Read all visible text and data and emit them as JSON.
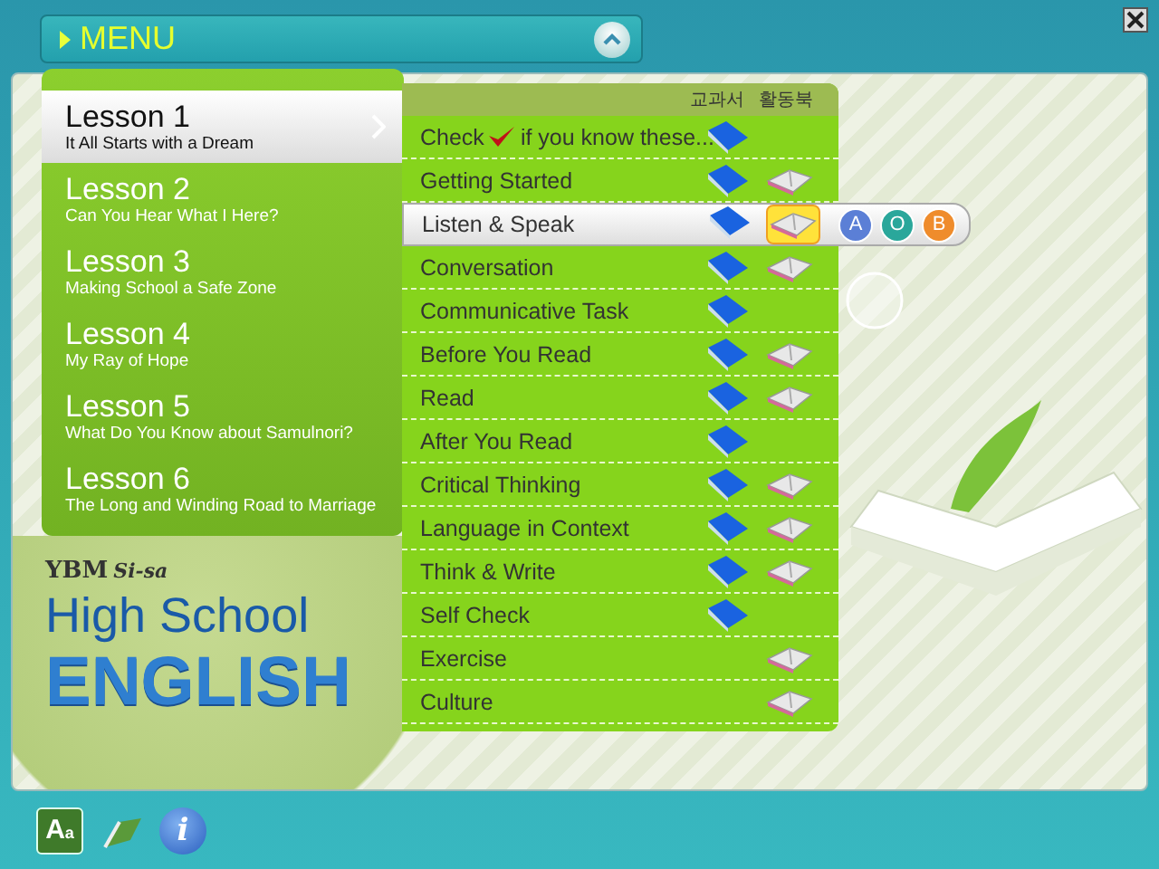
{
  "menu": {
    "title": "MENU",
    "expanded": true
  },
  "lessons": [
    {
      "title": "Lesson 1",
      "subtitle": "It All Starts with a Dream",
      "selected": true
    },
    {
      "title": "Lesson 2",
      "subtitle": "Can You Hear What I Here?",
      "selected": false
    },
    {
      "title": "Lesson 3",
      "subtitle": "Making School a Safe Zone",
      "selected": false
    },
    {
      "title": "Lesson 4",
      "subtitle": "My Ray of Hope",
      "selected": false
    },
    {
      "title": "Lesson 5",
      "subtitle": "What Do You Know about Samulnori?",
      "selected": false
    },
    {
      "title": "Lesson 6",
      "subtitle": "The Long and Winding Road to Marriage",
      "selected": false
    }
  ],
  "submenu": {
    "columns": [
      "교과서",
      "활동북"
    ],
    "items": [
      {
        "kind": "check",
        "label": "Check",
        "label_after": "if you know these...",
        "textbook": true,
        "workbook": false,
        "workbook_active": false,
        "selected": false
      },
      {
        "kind": "plain",
        "label": "Getting Started",
        "textbook": true,
        "workbook": true,
        "workbook_active": false,
        "selected": false
      },
      {
        "kind": "plain",
        "label": "Listen & Speak",
        "textbook": true,
        "workbook": true,
        "workbook_active": true,
        "selected": true,
        "options": [
          {
            "label": "A",
            "color": "#5b7fd6"
          },
          {
            "label": "O",
            "color": "#2aa79b"
          },
          {
            "label": "B",
            "color": "#ef8c2c"
          }
        ]
      },
      {
        "kind": "plain",
        "label": "Conversation",
        "textbook": true,
        "workbook": true,
        "workbook_active": false,
        "selected": false
      },
      {
        "kind": "plain",
        "label": "Communicative Task",
        "textbook": true,
        "workbook": false,
        "workbook_active": false,
        "selected": false
      },
      {
        "kind": "plain",
        "label": "Before You Read",
        "textbook": true,
        "workbook": true,
        "workbook_active": false,
        "selected": false
      },
      {
        "kind": "plain",
        "label": "Read",
        "textbook": true,
        "workbook": true,
        "workbook_active": false,
        "selected": false
      },
      {
        "kind": "plain",
        "label": "After You Read",
        "textbook": true,
        "workbook": false,
        "workbook_active": false,
        "selected": false
      },
      {
        "kind": "plain",
        "label": "Critical Thinking",
        "textbook": true,
        "workbook": true,
        "workbook_active": false,
        "selected": false
      },
      {
        "kind": "plain",
        "label": "Language in Context",
        "textbook": true,
        "workbook": true,
        "workbook_active": false,
        "selected": false
      },
      {
        "kind": "plain",
        "label": "Think & Write",
        "textbook": true,
        "workbook": true,
        "workbook_active": false,
        "selected": false
      },
      {
        "kind": "plain",
        "label": "Self Check",
        "textbook": true,
        "workbook": false,
        "workbook_active": false,
        "selected": false
      },
      {
        "kind": "plain",
        "label": "Exercise",
        "textbook": false,
        "workbook": true,
        "workbook_active": false,
        "selected": false
      },
      {
        "kind": "plain",
        "label": "Culture",
        "textbook": false,
        "workbook": true,
        "workbook_active": false,
        "selected": false
      }
    ]
  },
  "logo": {
    "publisher": "YBM",
    "imprint": "Si-sa",
    "line1": "High School",
    "line2": "ENGLISH"
  },
  "toolbar": [
    {
      "kind": "font",
      "label": "A",
      "label_small": "a"
    },
    {
      "kind": "bookmark"
    },
    {
      "kind": "info",
      "label": "i"
    }
  ]
}
